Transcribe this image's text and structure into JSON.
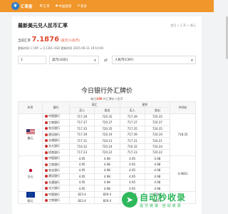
{
  "nav": {
    "logo_text": "汇率查",
    "items": [
      {
        "label": "汇率"
      },
      {
        "label": "中国金银"
      },
      {
        "label": "更多"
      }
    ]
  },
  "page": {
    "title": "最新美元兑人民币汇率",
    "breadcrumb": "首页 > 汇率 > 美元",
    "rate_label": "当前汇率",
    "rate_value": "7.1876",
    "rate_note": "(美元/人民币)",
    "rate_sub": "1 美元 = 7.1876 人民币, 1 CNY = 0.1391 USD",
    "update_line": "更新时间 1 CNY = 0.1391 USD 更新时间 2025-06-11 19:10:00"
  },
  "converter": {
    "amount": "1",
    "from_currency": "美元(USD)",
    "to_currency": "人民币(CNY)",
    "arrow": "⇄"
  },
  "table_section": {
    "title": "今日银行外汇牌价",
    "subtitle_prefix": "每日",
    "subtitle_count": "100",
    "subtitle_suffix": " 外汇牌价人民币",
    "headers": {
      "currency": "外币",
      "bank": "银行",
      "spot": "现汇",
      "cash": "现钞",
      "buy": "买入",
      "sell": "卖出",
      "mid": "中间价"
    },
    "groups": [
      {
        "name": "美元",
        "mid": "718.35",
        "flag": "us",
        "rows": [
          {
            "bank": "中国银行",
            "v1": "717.39",
            "v2": "720.35",
            "v3": "717.39",
            "v4": "720.35"
          },
          {
            "bank": "工商银行",
            "v1": "717.37",
            "v2": "720.37",
            "v3": "717.37",
            "v4": "720.37"
          },
          {
            "bank": "农业银行",
            "v1": "717.35",
            "v2": "720.35",
            "v3": "717.35",
            "v4": "720.35"
          },
          {
            "bank": "建设银行",
            "v1": "717.39",
            "v2": "720.19",
            "v3": "717.39",
            "v4": "720.19"
          },
          {
            "bank": "交通银行",
            "v1": "717.31",
            "v2": "720.21",
            "v3": "717.31",
            "v4": "720.21"
          },
          {
            "bank": "光大银行",
            "v1": "716.32",
            "v2": "720.24",
            "v3": "716.32",
            "v4": "720.24"
          },
          {
            "bank": "招商银行",
            "v1": "717.23",
            "v2": "720.22",
            "v3": "717.23",
            "v4": "720.22"
          }
        ]
      },
      {
        "name": "日元",
        "mid": "4.9661",
        "flag": "jp",
        "rows": [
          {
            "bank": "中国银行",
            "v1": "4.95",
            "v2": "4.98",
            "v3": "4.95",
            "v4": "4.98"
          },
          {
            "bank": "工商银行",
            "v1": "4.95",
            "v2": "4.98",
            "v3": "4.95",
            "v4": "4.98"
          },
          {
            "bank": "农业银行",
            "v1": "4.95",
            "v2": "4.98",
            "v3": "4.95",
            "v4": "4.98"
          },
          {
            "bank": "建设银行",
            "v1": "4.95",
            "v2": "4.98",
            "v3": "4.95",
            "v4": "4.98"
          },
          {
            "bank": "交通银行",
            "v1": "4.95",
            "v2": "4.98",
            "v3": "4.95",
            "v4": "4.98"
          },
          {
            "bank": "光大银行",
            "v1": "4.95",
            "v2": "4.98",
            "v3": "4.95",
            "v4": "4.98"
          }
        ]
      },
      {
        "name": "欧元",
        "mid": "",
        "flag": "eu",
        "rows": [
          {
            "bank": "中国银行",
            "v1": "823.4",
            "v2": "829.4",
            "v3": "823.4",
            "v4": "829.4"
          },
          {
            "bank": "工商银行",
            "v1": "823.4",
            "v2": "829.4",
            "v3": "823.4",
            "v4": "829.4"
          }
        ]
      }
    ]
  },
  "watermark": {
    "big": "自动秒收录",
    "small": "提交链接·自动收录",
    "icon": "rocket-icon"
  }
}
